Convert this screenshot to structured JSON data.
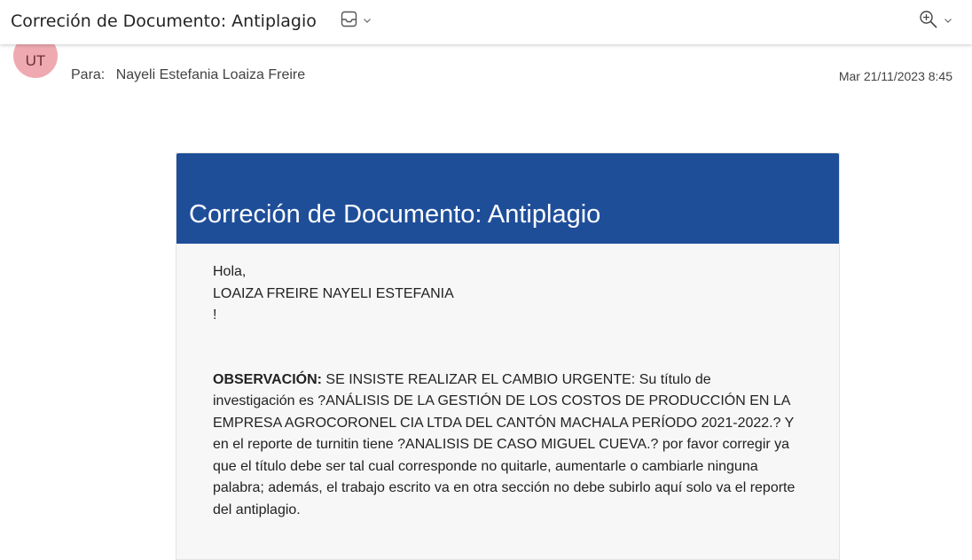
{
  "window": {
    "subject": "Correción de Documento: Antiplagio",
    "tag_icon": "tag-tray-icon",
    "zoom_icon": "zoom-in-icon"
  },
  "message": {
    "avatar_initials": "UT",
    "to_label": "Para:",
    "to_name": "Nayeli Estefania Loaiza Freire",
    "date": "Mar 21/11/2023 8:45"
  },
  "email": {
    "banner_title": "Correción de Documento: Antiplagio",
    "greeting": "Hola,",
    "recipient": "LOAIZA FREIRE NAYELI ESTEFANIA",
    "exclaim": "!",
    "obs_label": "OBSERVACIÓN:",
    "obs_line1": " SE INSISTE REALIZAR EL CAMBIO URGENTE: Su título de",
    "obs_line2": "investigación es ?ANÁLISIS DE LA GESTIÓN DE LOS COSTOS DE PRODUCCIÓN EN LA",
    "obs_line3": "EMPRESA AGROCORONEL CIA LTDA DEL CANTÓN MACHALA PERÍODO 2021-2022.? Y",
    "obs_line4": "en el reporte de turnitin tiene ?ANALISIS DE CASO MIGUEL CUEVA.? por favor corregir ya",
    "obs_line5": "que el título debe ser tal cual corresponde no quitarle, aumentarle o cambiarle ninguna",
    "obs_line6": "palabra; además, el trabajo escrito va en otra sección no debe subirlo aquí solo va el reporte",
    "obs_line7": "del antiplagio."
  }
}
